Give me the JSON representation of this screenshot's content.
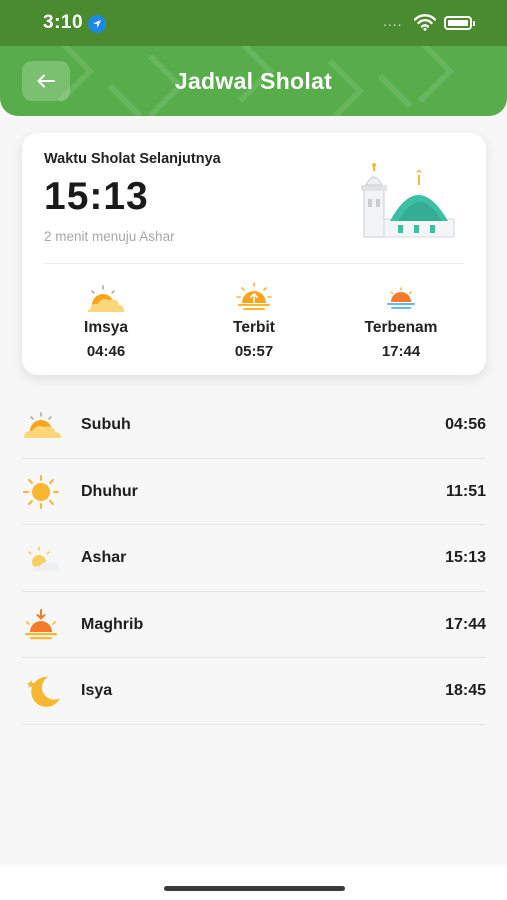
{
  "status_bar": {
    "time": "3:10",
    "signal": "...."
  },
  "header": {
    "title": "Jadwal Sholat",
    "back_icon": "arrow-left-icon"
  },
  "next_prayer": {
    "label": "Waktu Sholat Selanjutnya",
    "time": "15:13",
    "countdown": "2 menit menuju Ashar"
  },
  "sun_events": [
    {
      "name": "Imsya",
      "time": "04:46",
      "icon": "cloud-sun-icon"
    },
    {
      "name": "Terbit",
      "time": "05:57",
      "icon": "sunrise-icon"
    },
    {
      "name": "Terbenam",
      "time": "17:44",
      "icon": "sunset-icon"
    }
  ],
  "prayers": [
    {
      "name": "Subuh",
      "time": "04:56",
      "icon": "dawn-icon"
    },
    {
      "name": "Dhuhur",
      "time": "11:51",
      "icon": "sun-icon"
    },
    {
      "name": "Ashar",
      "time": "15:13",
      "icon": "afternoon-icon"
    },
    {
      "name": "Maghrib",
      "time": "17:44",
      "icon": "sunset-icon"
    },
    {
      "name": "Isya",
      "time": "18:45",
      "icon": "moon-icon"
    }
  ],
  "colors": {
    "header_green": "#56ad4a",
    "status_green": "#4b8b2f",
    "sun_orange": "#f7a51c",
    "dome_teal": "#3dbfa4"
  }
}
